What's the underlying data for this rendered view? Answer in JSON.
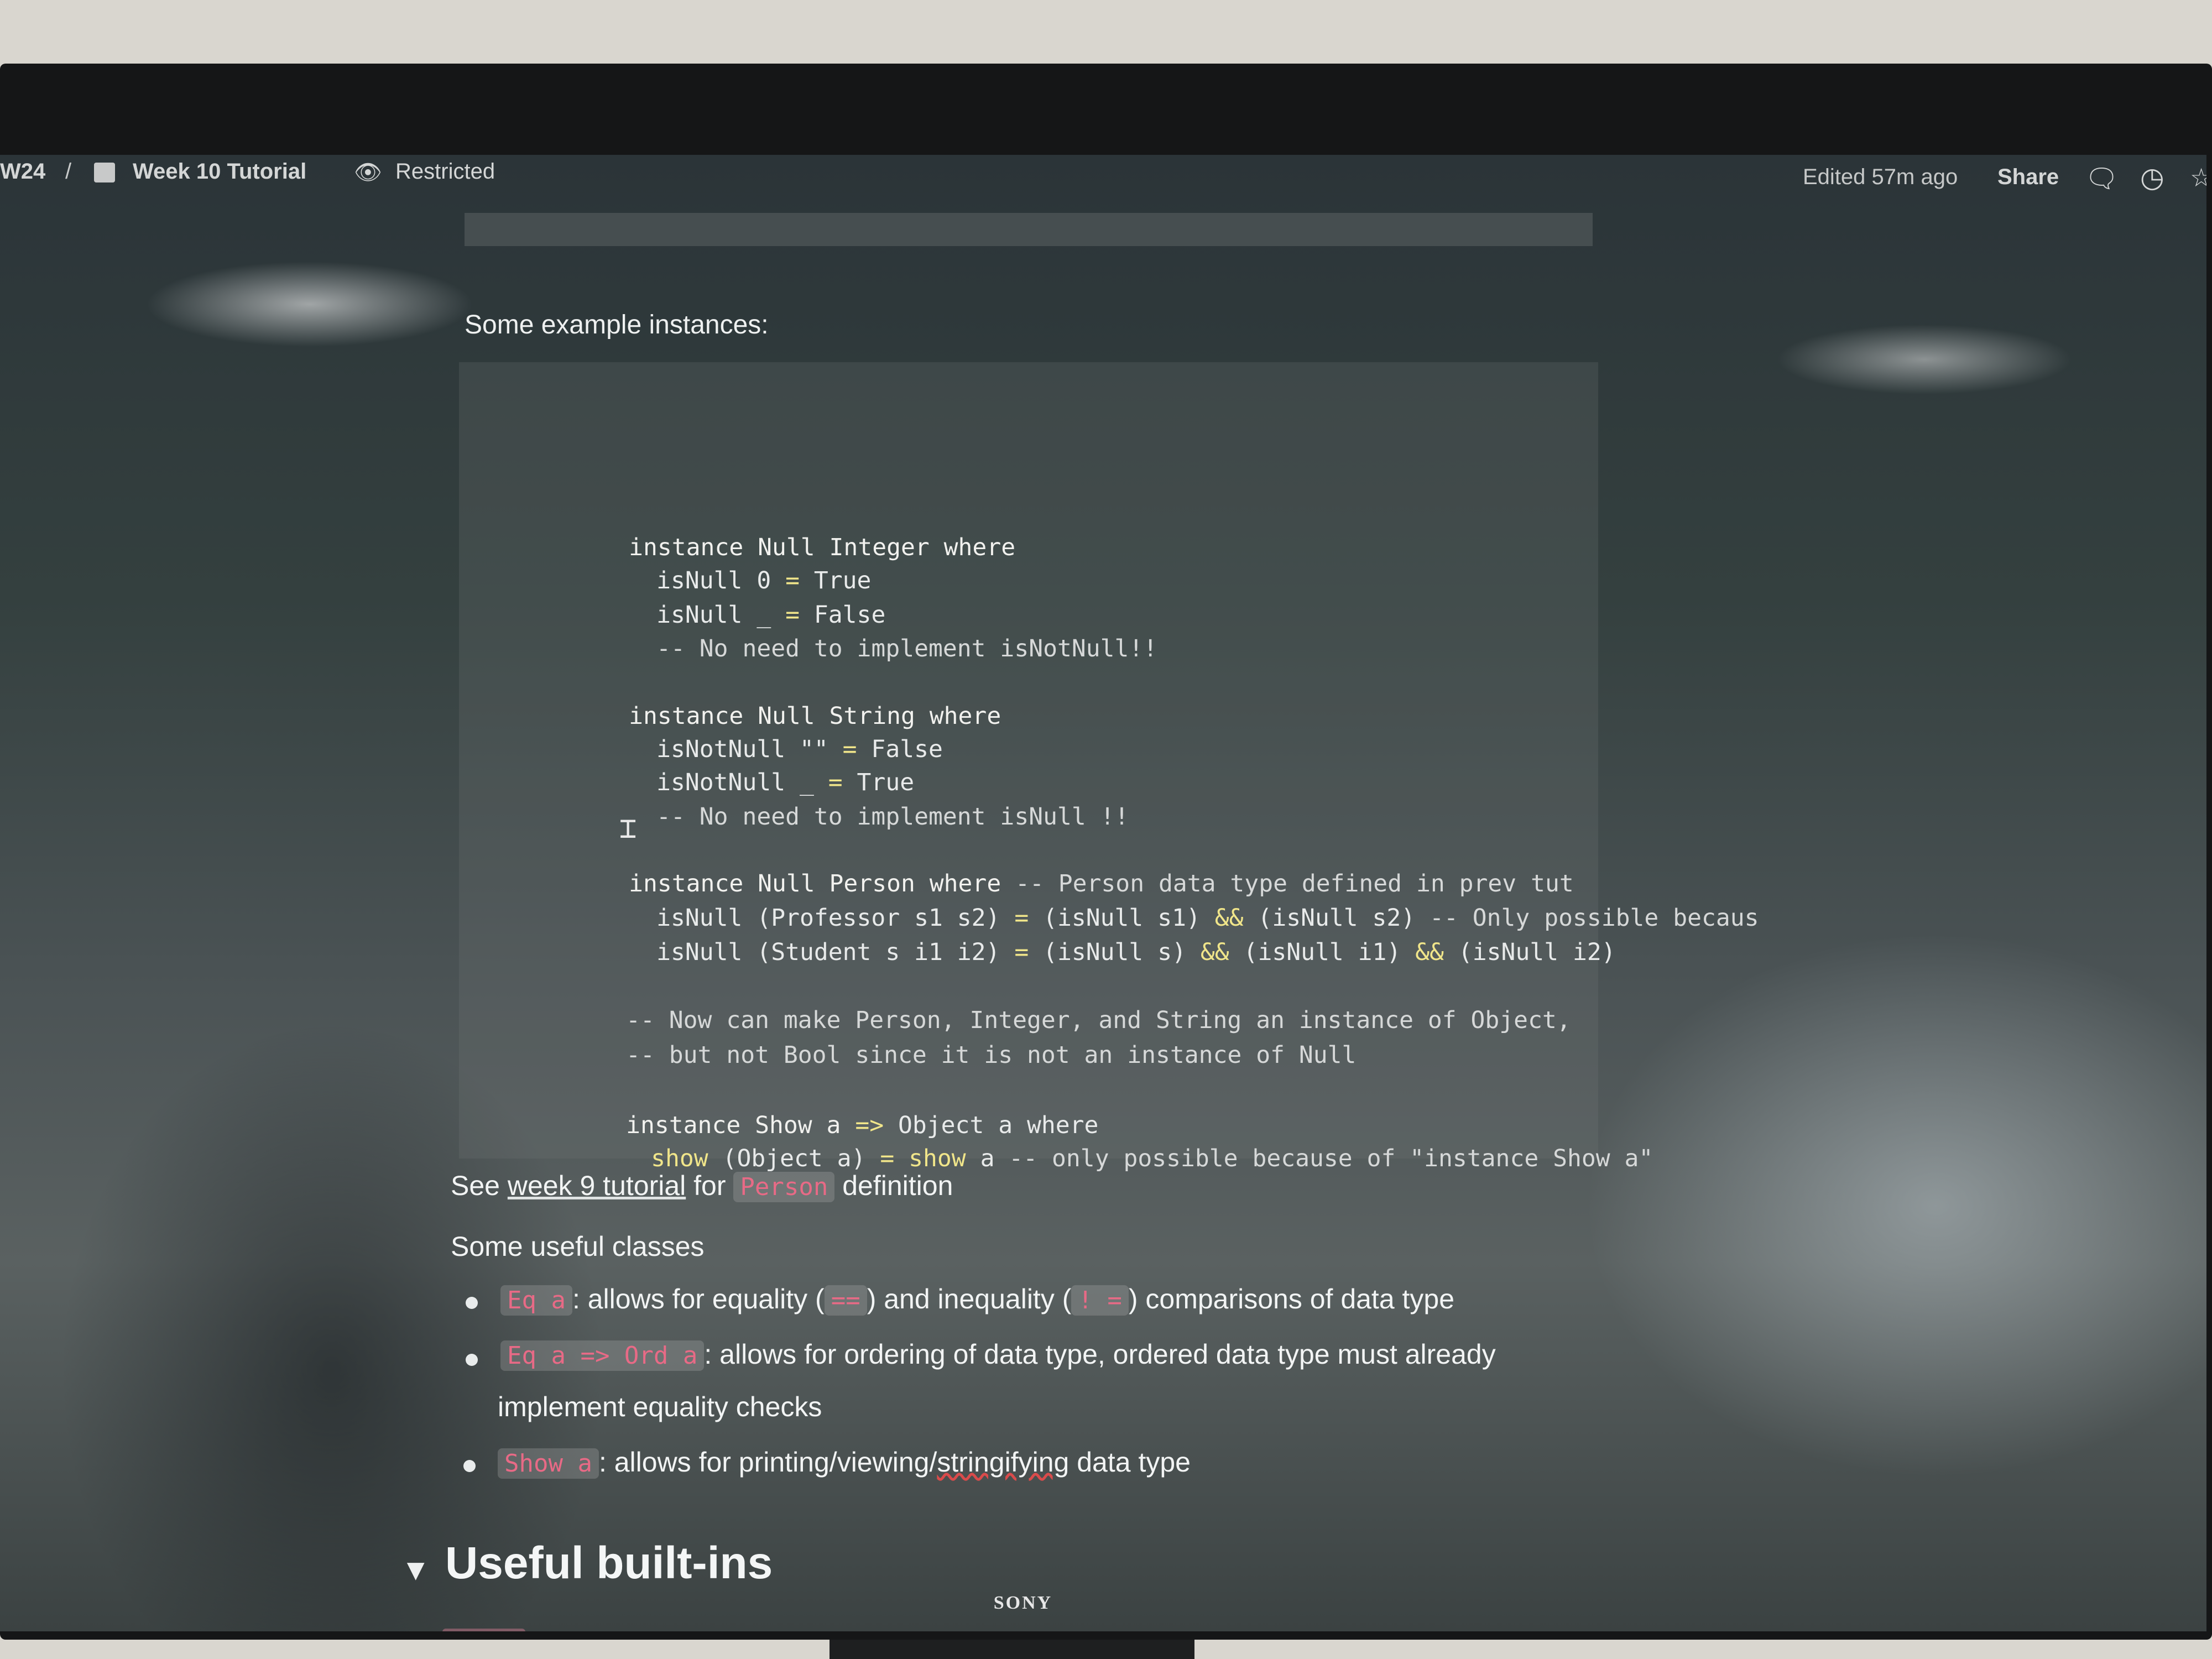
{
  "topbar": {
    "breadcrumb_root": "W24",
    "breadcrumb_sep": "/",
    "page_icon": "page-icon",
    "page_title": "Week 10 Tutorial",
    "visibility_icon": "eye-icon",
    "visibility": "Restricted",
    "edited": "Edited 57m ago",
    "share": "Share",
    "icons": [
      "comment-icon",
      "history-icon",
      "star-icon"
    ]
  },
  "content": {
    "examples_label": "Some example instances:",
    "code": {
      "l1": [
        "instance Null Integer where"
      ],
      "l2": [
        "isNull 0 ",
        "=",
        " True"
      ],
      "l3": [
        "isNull _ ",
        "=",
        " False"
      ],
      "l4": [
        "-- No need to implement isNotNull!!"
      ],
      "l5": [
        "instance Null String where"
      ],
      "l6": [
        "isNotNull \"\" ",
        "=",
        " False"
      ],
      "l7": [
        "isNotNull _ ",
        "=",
        " True"
      ],
      "l8": [
        "-- No need to implement isNull !!"
      ],
      "l9": [
        "instance Null Person where ",
        "-- Person data type defined in prev tut"
      ],
      "l10": [
        "isNull (Professor s1 s2) ",
        "=",
        " (isNull s1) ",
        "&&",
        " (isNull s2) ",
        "-- Only possible becaus"
      ],
      "l11": [
        "isNull (Student s i1 i2) ",
        "=",
        " (isNull s) ",
        "&&",
        " (isNull i1) ",
        "&&",
        " (isNull i2)"
      ],
      "l12": [
        "-- Now can make Person, Integer, and String an instance of Object,"
      ],
      "l13": [
        "-- but not Bool since it is not an instance of Null"
      ],
      "l14": [
        "instance Show a ",
        "=>",
        " Object a where"
      ],
      "l15": [
        "show",
        " (Object a) ",
        "=",
        " ",
        "show",
        " a ",
        "-- only possible because of \"instance Show a\""
      ]
    },
    "see_prefix": "See ",
    "see_link": "week 9 tutorial",
    "see_mid": " for ",
    "see_code": "Person",
    "see_suffix": " definition",
    "classes_label": "Some useful classes",
    "classes": [
      {
        "code": "Eq a",
        "text_a": ": allows for equality (",
        "code2": "==",
        "text_b": ") and inequality (",
        "code3": "! =",
        "text_c": ") comparisons of data type"
      },
      {
        "code": "Eq a => Ord a",
        "text_a": ": allows for ordering of data type, ordered data type must already",
        "text_b": "implement equality checks"
      },
      {
        "code": "Show a",
        "text_a": ": allows for printing/viewing/",
        "text_spell": "stringifying",
        "text_b": " data type"
      }
    ],
    "toggle_icon": "triangle-down-icon",
    "builtins_heading": "Useful built-ins"
  },
  "monitor": {
    "brand": "SONY"
  }
}
